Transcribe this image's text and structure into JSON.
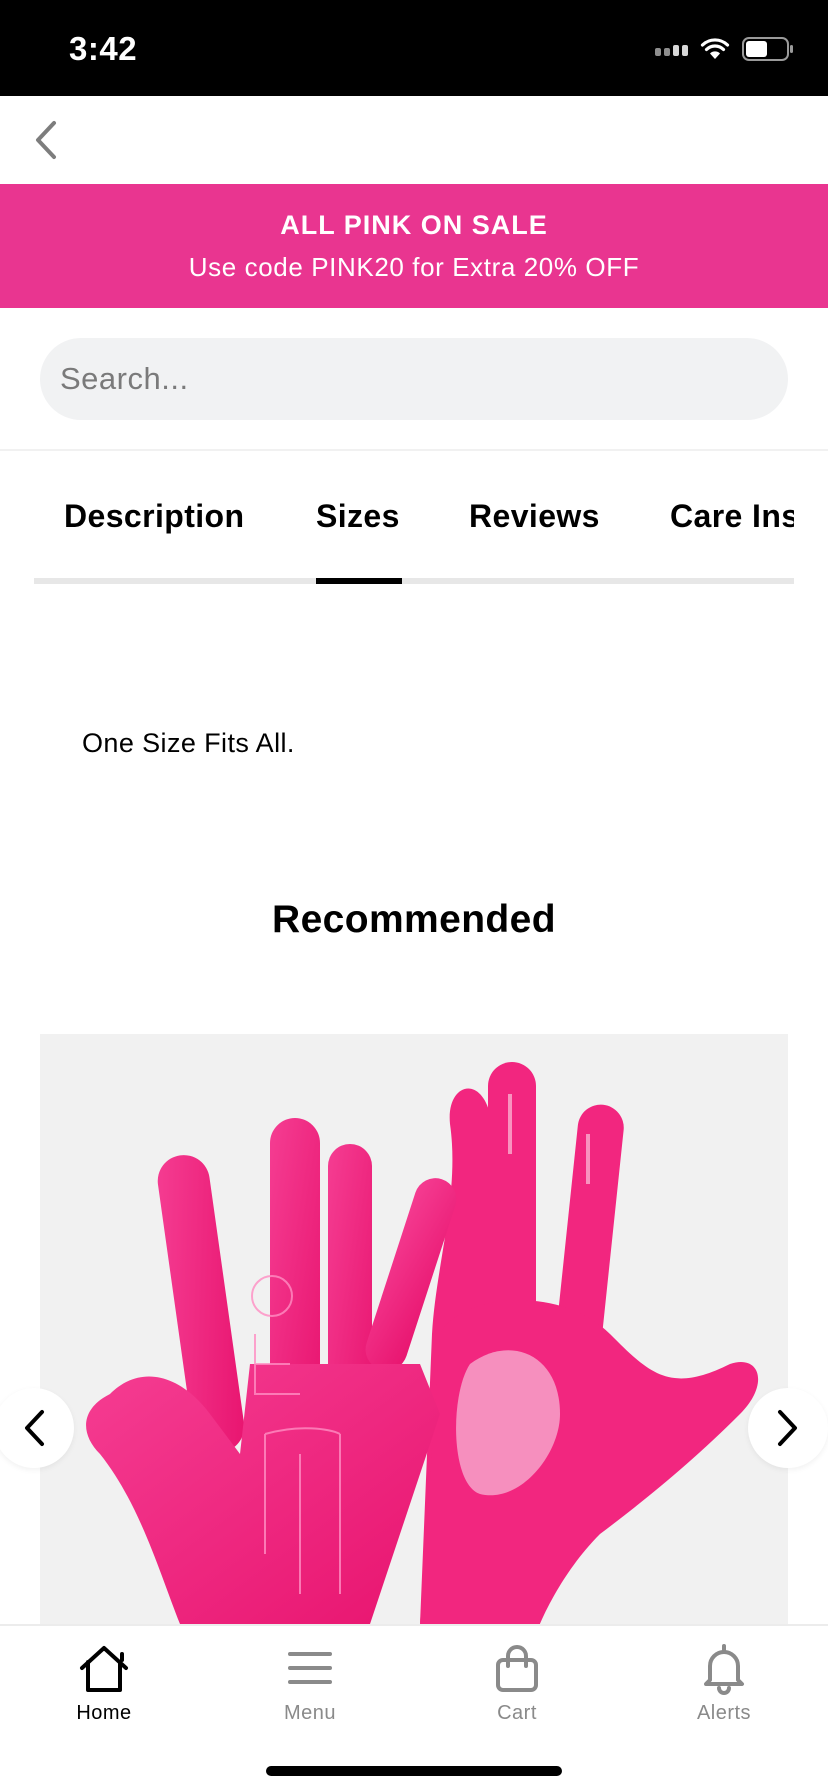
{
  "status_bar": {
    "time": "3:42",
    "icons": [
      "cellular-signal-icon",
      "wifi-icon",
      "battery-icon"
    ]
  },
  "nav": {
    "back_icon": "chevron-left-icon"
  },
  "promo": {
    "title": "ALL PINK ON SALE",
    "subtitle": "Use code PINK20 for Extra 20% OFF",
    "background_color": "#e93590"
  },
  "search": {
    "value": "",
    "placeholder": "Search..."
  },
  "tabs": {
    "items": [
      {
        "label": "Description",
        "active": false
      },
      {
        "label": "Sizes",
        "active": true
      },
      {
        "label": "Reviews",
        "active": false
      },
      {
        "label": "Care Ins",
        "active": false
      }
    ]
  },
  "sizes_panel": {
    "text": "One Size Fits All."
  },
  "recommended": {
    "title": "Recommended",
    "product_image": "pink-football-gloves",
    "prev_icon": "chevron-left-icon",
    "next_icon": "chevron-right-icon"
  },
  "bottom_nav": {
    "items": [
      {
        "label": "Home",
        "icon": "home-icon",
        "active": true
      },
      {
        "label": "Menu",
        "icon": "menu-icon",
        "active": false
      },
      {
        "label": "Cart",
        "icon": "shopping-bag-icon",
        "active": false
      },
      {
        "label": "Alerts",
        "icon": "bell-icon",
        "active": false
      }
    ]
  },
  "colors": {
    "accent": "#e93590",
    "glove_pink": "#f2267f",
    "inactive_gray": "#8a8a8a"
  }
}
